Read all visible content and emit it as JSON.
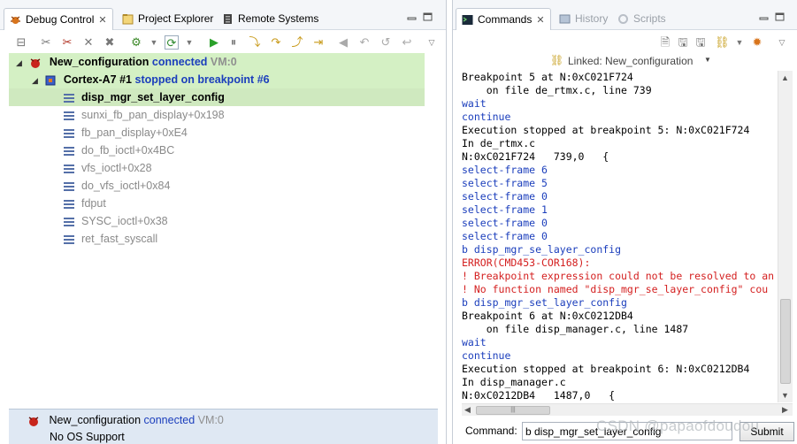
{
  "left": {
    "tabs": [
      {
        "label": "Debug Control",
        "icon": "debug-bug-icon",
        "active": true
      },
      {
        "label": "Project Explorer",
        "icon": "project-explorer-icon",
        "active": false
      },
      {
        "label": "Remote Systems",
        "icon": "remote-systems-icon",
        "active": false
      }
    ],
    "tree": {
      "connection": {
        "name": "New_configuration",
        "state": "connected",
        "vm": "VM:0"
      },
      "core": {
        "name": "Cortex-A7 #1",
        "state": "stopped on breakpoint #6"
      },
      "frames": [
        "disp_mgr_set_layer_config",
        "sunxi_fb_pan_display+0x198",
        "fb_pan_display+0xE4",
        "do_fb_ioctl+0x4BC",
        "vfs_ioctl+0x28",
        "do_vfs_ioctl+0x84",
        "fdput",
        "SYSC_ioctl+0x38",
        "ret_fast_syscall"
      ]
    },
    "status": {
      "name": "New_configuration",
      "state": "connected",
      "vm": "VM:0",
      "os": "No OS Support"
    }
  },
  "right": {
    "tabs": [
      {
        "label": "Commands",
        "icon": "terminal-icon",
        "active": true
      },
      {
        "label": "History",
        "icon": "history-icon",
        "active": false
      },
      {
        "label": "Scripts",
        "icon": "scripts-icon",
        "active": false
      }
    ],
    "linked": "Linked: New_configuration",
    "console": [
      {
        "text": "Breakpoint 5 at N:0xC021F724",
        "style": "normal"
      },
      {
        "text": "    on file de_rtmx.c, line 739",
        "style": "normal"
      },
      {
        "text": "wait",
        "style": "blue"
      },
      {
        "text": "continue",
        "style": "blue"
      },
      {
        "text": "Execution stopped at breakpoint 5: N:0xC021F724",
        "style": "normal"
      },
      {
        "text": "In de_rtmx.c",
        "style": "normal"
      },
      {
        "text": "N:0xC021F724   739,0   {",
        "style": "normal"
      },
      {
        "text": "select-frame 6",
        "style": "blue"
      },
      {
        "text": "select-frame 5",
        "style": "blue"
      },
      {
        "text": "select-frame 0",
        "style": "blue"
      },
      {
        "text": "select-frame 1",
        "style": "blue"
      },
      {
        "text": "select-frame 0",
        "style": "blue"
      },
      {
        "text": "select-frame 0",
        "style": "blue"
      },
      {
        "text": "b disp_mgr_se_layer_config",
        "style": "blue"
      },
      {
        "text": "ERROR(CMD453-COR168):",
        "style": "red"
      },
      {
        "text": "! Breakpoint expression could not be resolved to an",
        "style": "red"
      },
      {
        "text": "! No function named \"disp_mgr_se_layer_config\" cou",
        "style": "red"
      },
      {
        "text": "b disp_mgr_set_layer_config",
        "style": "blue"
      },
      {
        "text": "Breakpoint 6 at N:0xC0212DB4",
        "style": "normal"
      },
      {
        "text": "    on file disp_manager.c, line 1487",
        "style": "normal"
      },
      {
        "text": "wait",
        "style": "blue"
      },
      {
        "text": "continue",
        "style": "blue"
      },
      {
        "text": "Execution stopped at breakpoint 6: N:0xC0212DB4",
        "style": "normal"
      },
      {
        "text": "In disp_manager.c",
        "style": "normal"
      },
      {
        "text": "N:0xC0212DB4   1487,0   {",
        "style": "normal"
      }
    ],
    "command": {
      "label": "Command:",
      "value": "b disp_mgr_set_layer_config",
      "submit": "Submit"
    }
  },
  "watermark": "CSDN @papaofdoudou",
  "colors": {
    "connected": "#1b3ebc",
    "error": "#d42020",
    "highlight": "#d4f0c4",
    "status_bg": "#dfe8f3"
  }
}
